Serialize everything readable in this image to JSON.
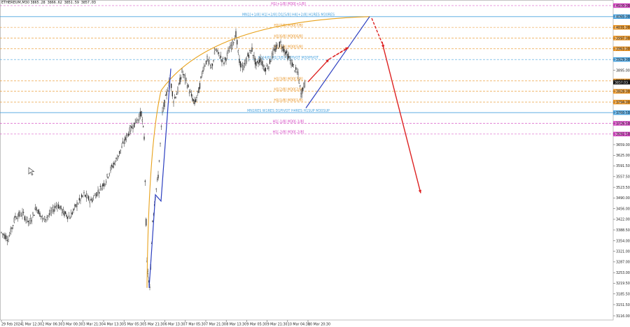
{
  "header": {
    "symbol": "ETHEREUM,M30",
    "ohlc": "3865.28 3866.62 3851.59 3857.03"
  },
  "colors": {
    "candle": "#222222",
    "level_blue": "#4aa3df",
    "level_magenta": "#d23fbf",
    "level_orange": "#e8901c",
    "arc": "#e8a21c",
    "wave": "#2c3fc0",
    "projection": "#dd2222",
    "grid_pink": "#e0a0c8"
  },
  "chart_data": {
    "type": "candlestick",
    "title": "ETHEREUM,M30",
    "y_axis_ticks": [
      "4100.00",
      "4065.00",
      "4031.00",
      "3997.00",
      "3963.00",
      "3929.00",
      "3895.00",
      "3861.00",
      "3828.00",
      "3794.00",
      "3760.50",
      "3726.50",
      "3692.50",
      "3659.00",
      "3625.00",
      "3591.50",
      "3557.50",
      "3523.50",
      "3490.00",
      "3456.00",
      "3422.00",
      "3388.50",
      "3354.00",
      "3321.00",
      "3287.00",
      "3253.00",
      "3219.50",
      "3185.50",
      "3151.50",
      "3116.00"
    ],
    "x_axis_ticks": [
      "29 Feb 2024",
      "1 Mar 12:30",
      "2 Mar 06:30",
      "3 Mar 00:30",
      "3 Mar 21:30",
      "4 Mar 13:30",
      "5 Mar 05:30",
      "5 Mar 21:30",
      "6 Mar 13:30",
      "7 Mar 05:30",
      "7 Mar 21:30",
      "8 Mar 13:30",
      "9 Mar 05:30",
      "9 Mar 21:30",
      "10 Mar 04:30",
      "10 Mar 20:30"
    ],
    "ylim": [
      3116,
      4120
    ],
    "levels": [
      {
        "label": "H1[+1/8] M30[+1/8]",
        "price": 4100,
        "tag": "4100.00",
        "color": "#d23fbf",
        "style": "dash"
      },
      {
        "label": "MN1[+1/8] H1[+2/8] D1[5/8] H4[+2/8] H1RES M30RES",
        "price": 4065,
        "tag": "4065.00",
        "color": "#4aa3df",
        "style": "solid"
      },
      {
        "label": "H1[7/8] M30[7/8]",
        "price": 4031,
        "tag": "4031.00",
        "color": "#e8901c",
        "style": "dash"
      },
      {
        "label": "H1[6/8] M30[6/8]",
        "price": 3997,
        "tag": "3997.00",
        "color": "#e8901c",
        "style": "dash"
      },
      {
        "label": "H1[5/8] M30[5/8]",
        "price": 3963,
        "tag": "3963.00",
        "color": "#e8901c",
        "style": "dash"
      },
      {
        "label": "H1[4/8] H1[3/8] H1PIVOT M30PIVOT",
        "price": 3929,
        "tag": "3929.00",
        "color": "#4aa3df",
        "style": "dash"
      },
      {
        "label": "H1[3/8] M30[3/8]",
        "price": 3861,
        "tag": "3861.00",
        "color": "#e8901c",
        "style": "dash"
      },
      {
        "label": "H1[2/8] M30[2/8]",
        "price": 3828,
        "tag": "3828.00",
        "color": "#e8901c",
        "style": "dash"
      },
      {
        "label": "H1[1/8] M30[1/8]",
        "price": 3794,
        "tag": "3794.00",
        "color": "#e8901c",
        "style": "dash"
      },
      {
        "label": "MN1RES W1RES D1PIVOT H4RES H1SUP M30SUP",
        "price": 3760.5,
        "tag": "3760.50",
        "color": "#4aa3df",
        "style": "solid"
      },
      {
        "label": "H1[-1/8] M30[-1/8]",
        "price": 3726.5,
        "tag": "3726.50",
        "color": "#d23fbf",
        "style": "dash"
      },
      {
        "label": "H1[-2/8] M30[-2/8]",
        "price": 3692.5,
        "tag": "3692.50",
        "color": "#d23fbf",
        "style": "dash"
      }
    ],
    "current_price": {
      "value": 3857.03,
      "tag": "3857.03"
    }
  }
}
